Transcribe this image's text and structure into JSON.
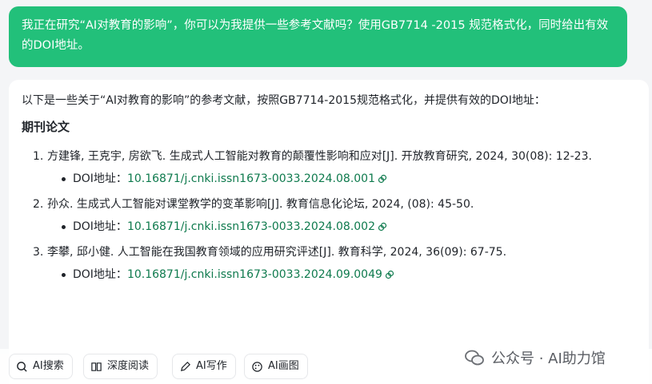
{
  "user_message": "我正在研究“AI对教育的影响”，你可以为我提供一些参考文献吗？使用GB7714 -2015 规范格式化，同时给出有效的DOI地址。",
  "answer": {
    "intro": "以下是一些关于“AI对教育的影响”的参考文献，按照GB7714-2015规范格式化，并提供有效的DOI地址：",
    "section_title": "期刊论文",
    "doi_prefix": "DOI地址：",
    "refs": [
      {
        "num": "1.",
        "text": "方建锋, 王克宇, 房欲飞. 生成式人工智能对教育的颠覆性影响和应对[J]. 开放教育研究, 2024, 30(08): 12-23.",
        "doi": "10.16871/j.cnki.issn1673-0033.2024.08.001"
      },
      {
        "num": "2.",
        "text": "孙众. 生成式人工智能对课堂教学的变革影响[J]. 教育信息化论坛, 2024, (08): 45-50.",
        "doi": "10.16871/j.cnki.issn1673-0033.2024.08.002"
      },
      {
        "num": "3.",
        "text": "李攀, 邱小健. 人工智能在我国教育领域的应用研究评述[J]. 教育科学, 2024, 36(09): 67-75.",
        "doi": "10.16871/j.cnki.issn1673-0033.2024.09.0049"
      }
    ]
  },
  "toolbar": {
    "search_label": "AI搜索",
    "read_label": "深度阅读",
    "write_label": "AI写作",
    "draw_label": "AI画图"
  },
  "watermark": {
    "text": "公众号 · AI助力馆"
  },
  "colors": {
    "user_bubble": "#22c07a",
    "doi_link": "#0e7a4d"
  }
}
